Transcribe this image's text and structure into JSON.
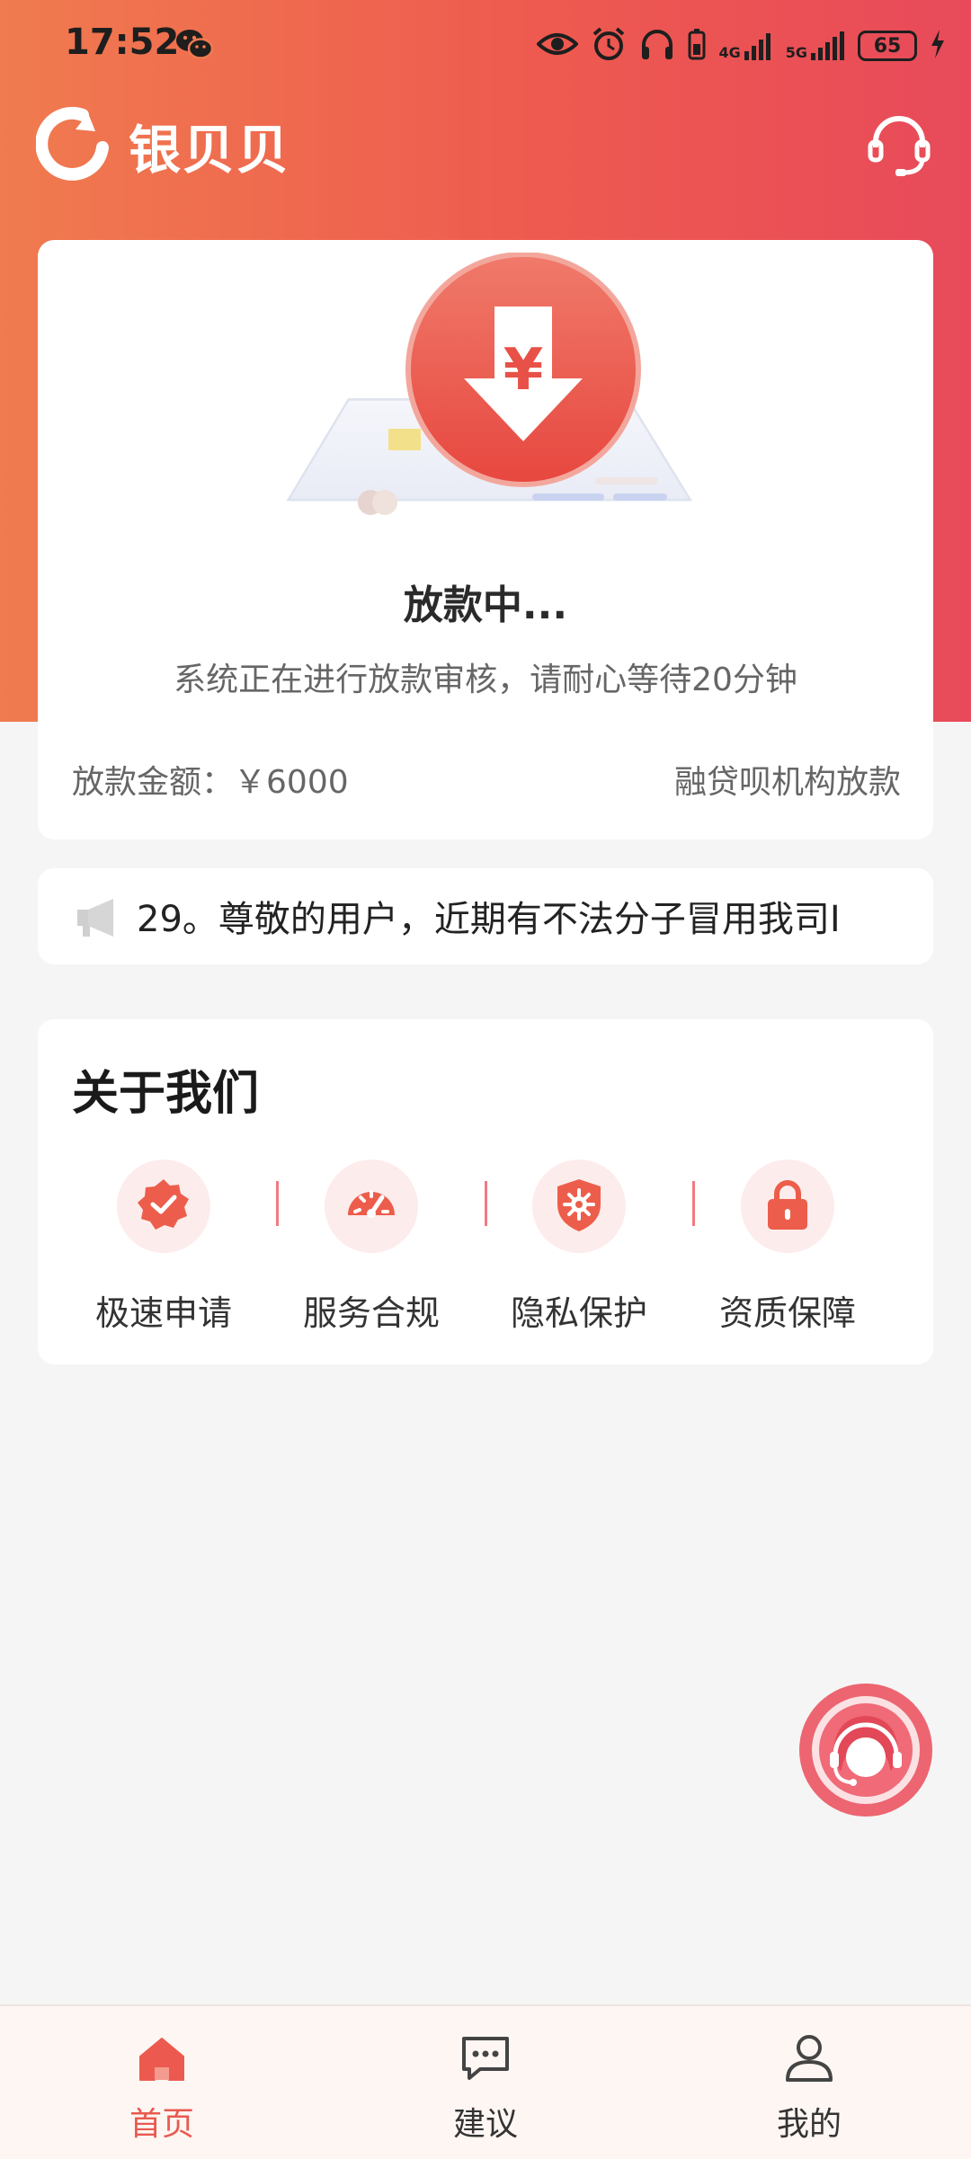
{
  "status_bar": {
    "time": "17:52",
    "battery": "65",
    "net1": "4G",
    "net2": "5G"
  },
  "header": {
    "app_name": "银贝贝"
  },
  "status_card": {
    "title": "放款中...",
    "description": "系统正在进行放款审核，请耐心等待20分钟",
    "amount_label": "放款金额：",
    "amount_value": "￥6000",
    "lender": "融贷呗机构放款"
  },
  "notice": {
    "text": "29。尊敬的用户，近期有不法分子冒用我司I"
  },
  "about": {
    "title": "关于我们",
    "features": [
      {
        "label": "极速申请",
        "icon": "check-badge-icon"
      },
      {
        "label": "服务合规",
        "icon": "speedometer-icon"
      },
      {
        "label": "隐私保护",
        "icon": "shield-icon"
      },
      {
        "label": "资质保障",
        "icon": "lock-icon"
      }
    ]
  },
  "tabbar": {
    "items": [
      {
        "label": "首页",
        "icon": "home-icon",
        "active": true
      },
      {
        "label": "建议",
        "icon": "chat-icon",
        "active": false
      },
      {
        "label": "我的",
        "icon": "user-icon",
        "active": false
      }
    ]
  },
  "colors": {
    "accent": "#ee5a4f",
    "gradient_start": "#f07b4f",
    "gradient_end": "#e84a5a",
    "background": "#f5f5f5"
  }
}
